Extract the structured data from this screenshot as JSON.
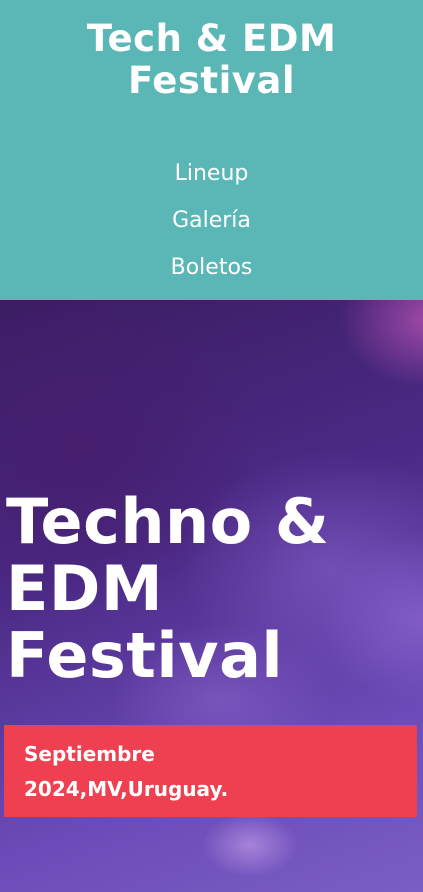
{
  "header": {
    "title": "Tech & EDM Festival",
    "background_color": "#5bb6b6",
    "nav": [
      {
        "label": "Lineup"
      },
      {
        "label": "Galería"
      },
      {
        "label": "Boletos"
      }
    ]
  },
  "hero": {
    "title": "Techno & EDM Festival",
    "date_text": "Septiembre 2024,MV,Uruguay.",
    "banner_color": "#ef4051"
  }
}
